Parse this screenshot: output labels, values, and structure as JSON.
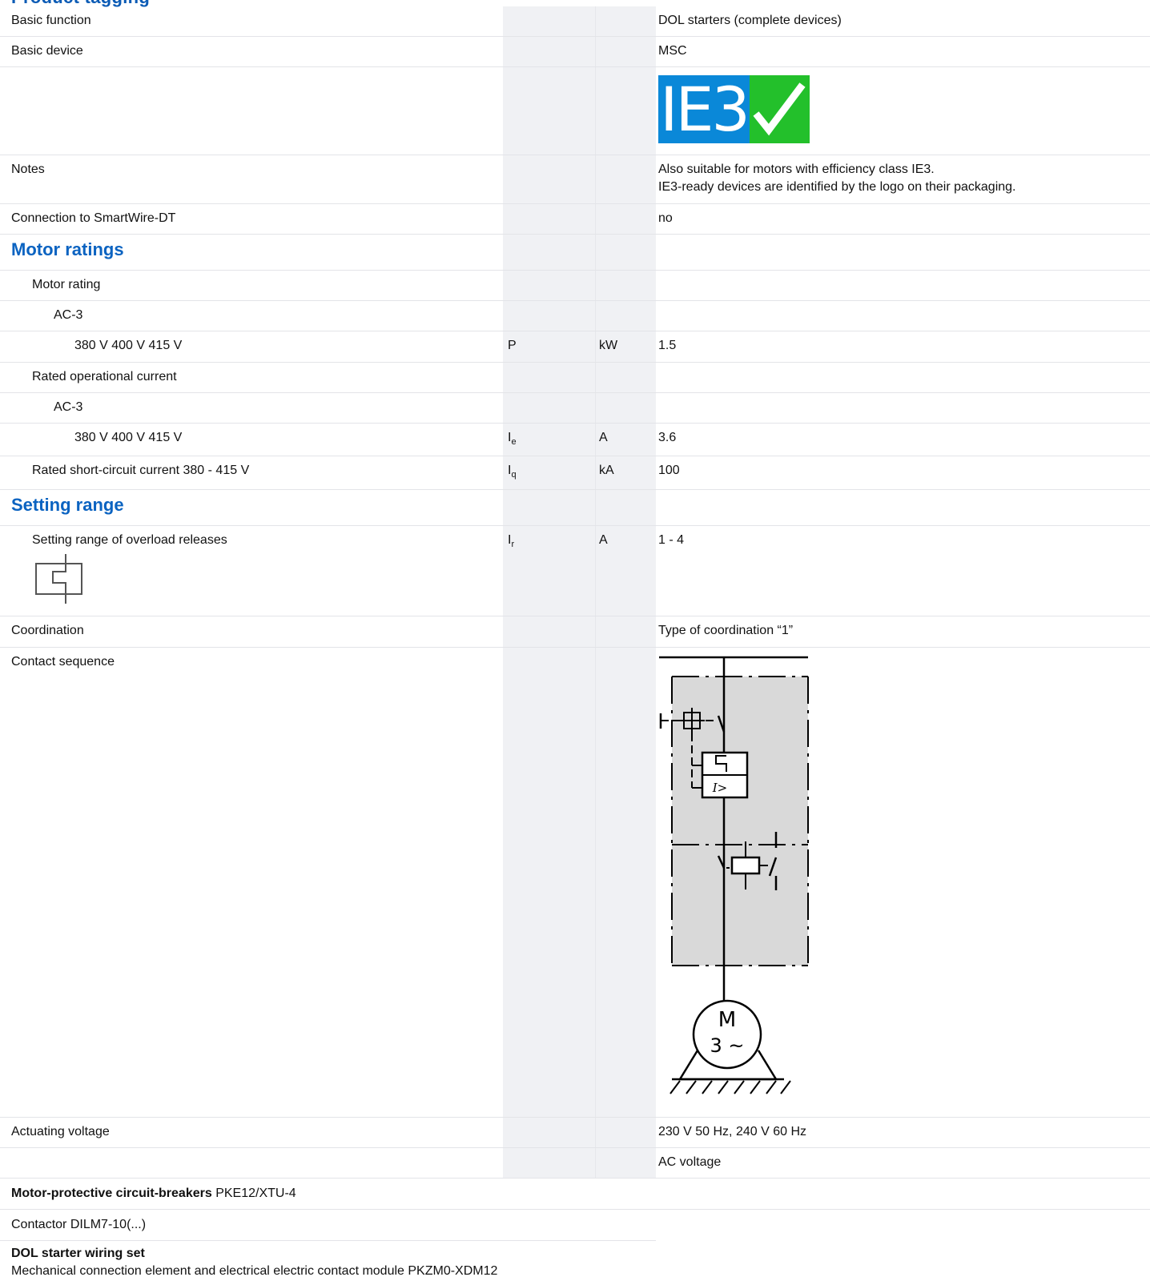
{
  "header_fragment": "Product tagging",
  "rows": {
    "basic_function": {
      "label": "Basic function",
      "value": "DOL starters (complete devices)"
    },
    "basic_device": {
      "label": "Basic device",
      "value": "MSC"
    },
    "ie3_logo": {
      "text": "IE3"
    },
    "notes": {
      "label": "Notes",
      "value_line1": "Also suitable for motors with efficiency class IE3.",
      "value_line2": "IE3-ready devices are identified by the logo on their packaging."
    },
    "smartwire": {
      "label": "Connection to SmartWire-DT",
      "value": "no"
    }
  },
  "motor_ratings": {
    "section_title": "Motor ratings",
    "motor_rating": "Motor rating",
    "ac3_a": "AC-3",
    "voltage_a": "380 V 400 V 415 V",
    "power": {
      "symbol": "P",
      "unit": "kW",
      "value": "1.5"
    },
    "rated_current": "Rated operational current",
    "ac3_b": "AC-3",
    "voltage_b": "380 V 400 V 415 V",
    "current": {
      "symbol": "I",
      "sub": "e",
      "unit": "A",
      "value": "3.6"
    },
    "short_circuit": {
      "label": "Rated short-circuit current 380 - 415 V",
      "symbol": "I",
      "sub": "q",
      "unit": "kA",
      "value": "100"
    }
  },
  "setting_range": {
    "section_title": "Setting range",
    "overload": {
      "label": "Setting range of overload releases",
      "symbol": "I",
      "sub": "r",
      "unit": "A",
      "value": "1 - 4"
    }
  },
  "coordination": {
    "label": "Coordination",
    "value": "Type of coordination “1”"
  },
  "contact_sequence": {
    "label": "Contact sequence",
    "motor_m": "M",
    "motor_3": "3 ~",
    "current_label": "I>"
  },
  "actuating": {
    "label": "Actuating voltage",
    "value1": "230 V 50 Hz, 240 V 60 Hz",
    "value2": "AC voltage"
  },
  "components": {
    "mpcb_bold": "Motor-protective circuit-breakers",
    "mpcb_value": "PKE12/XTU-4",
    "contactor": "Contactor DILM7-10(...)",
    "wiring_bold": "DOL starter wiring set",
    "wiring_value": "Mechanical connection element and electrical electric contact module PKZM0-XDM12"
  },
  "colors": {
    "section_blue": "#0b63c1",
    "band_gray": "#f0f1f4",
    "ie3_blue": "#0a88d8",
    "ie3_green": "#23c02b",
    "diagram_gray": "#d9d9d9"
  }
}
